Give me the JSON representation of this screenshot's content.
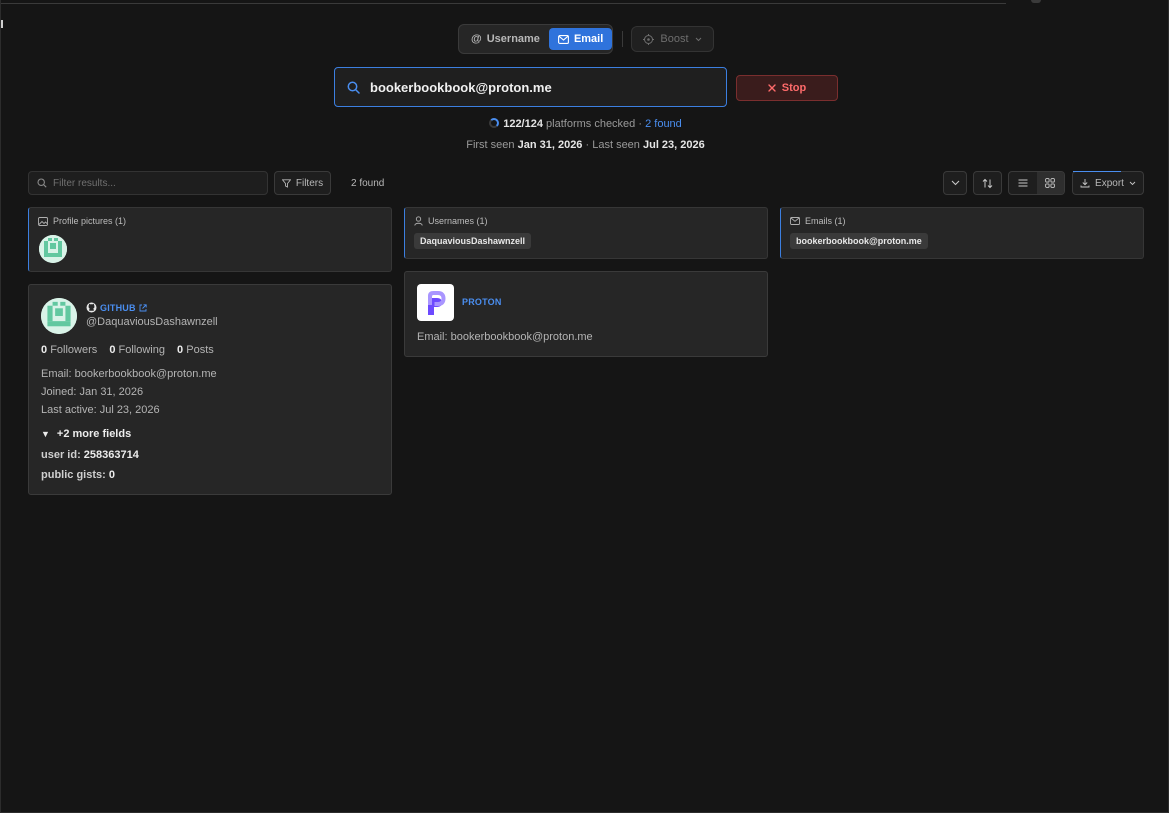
{
  "mode": {
    "username_label": "Username",
    "email_label": "Email",
    "active": "email",
    "boost_label": "Boost"
  },
  "search": {
    "value": "bookerbookbook@proton.me",
    "stop_label": "Stop"
  },
  "status": {
    "checked": "122/124",
    "checked_suffix": "platforms checked",
    "separator": "·",
    "found_label": "2 found",
    "first_seen_label": "First seen",
    "first_seen": "Jan 31, 2026",
    "last_seen_label": "· Last seen",
    "last_seen": "Jul 23, 2026"
  },
  "toolbar": {
    "filter_placeholder": "Filter results...",
    "filters_label": "Filters",
    "result_count": "2 found",
    "export_label": "Export"
  },
  "summary": {
    "profile_pictures": {
      "title": "Profile pictures (1)"
    },
    "usernames": {
      "title": "Usernames (1)",
      "items": [
        "DaquaviousDashawnzell"
      ]
    },
    "emails": {
      "title": "Emails (1)",
      "items": [
        "bookerbookbook@proton.me"
      ]
    }
  },
  "results": {
    "github": {
      "platform": "GITHUB",
      "handle": "@DaquaviousDashawnzell",
      "followers_count": "0",
      "followers_label": "Followers",
      "following_count": "0",
      "following_label": "Following",
      "posts_count": "0",
      "posts_label": "Posts",
      "email": "Email: bookerbookbook@proton.me",
      "joined": "Joined: Jan 31, 2026",
      "last_active": "Last active: Jul 23, 2026",
      "more_fields": "+2 more fields",
      "user_id_label": "user id:",
      "user_id": "258363714",
      "public_gists_label": "public gists:",
      "public_gists": "0"
    },
    "proton": {
      "platform": "PROTON",
      "email": "Email: bookerbookbook@proton.me"
    }
  },
  "colors": {
    "accent": "#2f73dc",
    "link": "#4a8ef0",
    "danger": "#ff6b6b",
    "background": "#151515",
    "card": "#262626",
    "proton_brand": "#6d4aff"
  },
  "icons": {
    "username": "at-icon",
    "email": "mail-icon",
    "boost": "crosshair-icon",
    "search": "search-icon",
    "stop": "close-icon",
    "filters": "funnel-icon",
    "sort": "sort-arrows-icon",
    "list_view": "list-icon",
    "grid_view": "grid-icon",
    "export": "download-icon"
  }
}
